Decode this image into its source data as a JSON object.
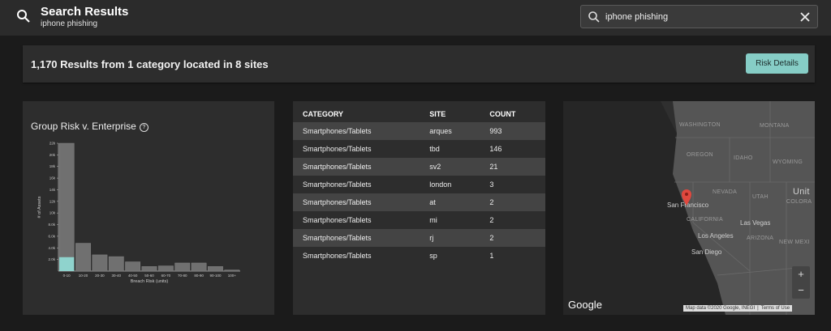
{
  "header": {
    "title": "Search Results",
    "subtitle": "iphone phishing",
    "search_value": "iphone phishing"
  },
  "summary": {
    "text": "1,170 Results from 1 category located in 8 sites",
    "risk_button": "Risk Details"
  },
  "chart_panel": {
    "title": "Group Risk v. Enterprise",
    "help_glyph": "?"
  },
  "chart_data": {
    "type": "bar",
    "title": "Group Risk v. Enterprise",
    "xlabel": "Breach Risk (units)",
    "ylabel": "# of Assets",
    "categories": [
      "0-10",
      "10-20",
      "20-30",
      "30-40",
      "40-50",
      "50-60",
      "60-70",
      "70-80",
      "80-90",
      "90-100",
      "100+"
    ],
    "series": [
      {
        "values": [
          22000,
          4800,
          2800,
          2500,
          1600,
          800,
          900,
          1400,
          1400,
          800,
          200
        ]
      },
      {
        "values": [
          2400,
          0,
          0,
          0,
          0,
          0,
          0,
          0,
          0,
          0,
          0
        ]
      }
    ],
    "y_ticks": [
      "2.0k",
      "4.0k",
      "6.0k",
      "8.0k",
      "10k",
      "12k",
      "14k",
      "16k",
      "18k",
      "20k",
      "22k"
    ],
    "y_tick_values": [
      2000,
      4000,
      6000,
      8000,
      10000,
      12000,
      14000,
      16000,
      18000,
      20000,
      22000
    ],
    "ylim": [
      0,
      22000
    ],
    "colors": {
      "enterprise": "#707070",
      "group": "#8fd3cd",
      "axis": "#bbbbbb"
    }
  },
  "table": {
    "headers": [
      "CATEGORY",
      "SITE",
      "COUNT"
    ],
    "rows": [
      [
        "Smartphones/Tablets",
        "arques",
        "993"
      ],
      [
        "Smartphones/Tablets",
        "tbd",
        "146"
      ],
      [
        "Smartphones/Tablets",
        "sv2",
        "21"
      ],
      [
        "Smartphones/Tablets",
        "london",
        "3"
      ],
      [
        "Smartphones/Tablets",
        "at",
        "2"
      ],
      [
        "Smartphones/Tablets",
        "mi",
        "2"
      ],
      [
        "Smartphones/Tablets",
        "rj",
        "2"
      ],
      [
        "Smartphones/Tablets",
        "sp",
        "1"
      ]
    ]
  },
  "map": {
    "labels": {
      "washington": "WASHINGTON",
      "montana": "MONTANA",
      "oregon": "OREGON",
      "idaho": "IDAHO",
      "wyoming": "WYOMING",
      "nevada": "NEVADA",
      "utah": "UTAH",
      "utah_big": "Unit",
      "colorado": "COLORA",
      "california": "CALIFORNIA",
      "arizona": "ARIZONA",
      "new_mexico": "NEW MEXI",
      "san_francisco": "San Francisco",
      "las_vegas": "Las Vegas",
      "los_angeles": "Los Angeles",
      "san_diego": "San Diego"
    },
    "brand": "Google",
    "attribution": "Map data ©2020 Google, INEGI",
    "terms": "Terms of Use",
    "zoom_in": "+",
    "zoom_out": "−",
    "pin_color": "#e0483e"
  }
}
